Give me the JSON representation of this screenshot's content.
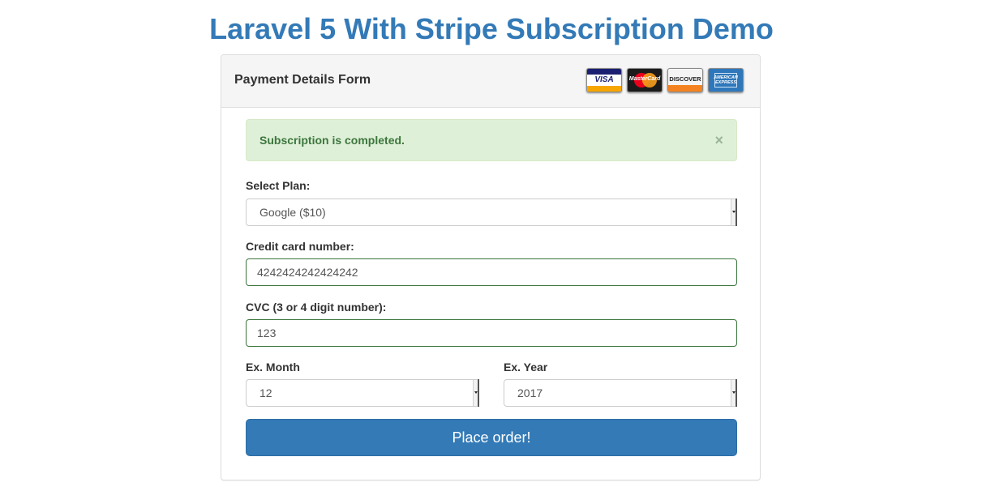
{
  "page": {
    "title": "Laravel 5 With Stripe Subscription Demo"
  },
  "panel": {
    "title": "Payment Details Form",
    "cards": [
      {
        "name": "visa",
        "text": "VISA"
      },
      {
        "name": "mastercard",
        "text": "MasterCard"
      },
      {
        "name": "discover",
        "text": "DISCOVER"
      },
      {
        "name": "american-express",
        "text": "AMERICAN EXPRESS"
      }
    ]
  },
  "alert": {
    "message": "Subscription is completed.",
    "close_symbol": "×"
  },
  "form": {
    "plan": {
      "label": "Select Plan:",
      "value": "Google ($10)"
    },
    "card_number": {
      "label": "Credit card number:",
      "value": "4242424242424242"
    },
    "cvc": {
      "label": "CVC (3 or 4 digit number):",
      "value": "123"
    },
    "exp_month": {
      "label": "Ex. Month",
      "value": "12"
    },
    "exp_year": {
      "label": "Ex. Year",
      "value": "2017"
    },
    "submit_label": "Place order!"
  },
  "colors": {
    "title": "#337ab7",
    "primary_button": "#337ab7",
    "alert_background": "#dff0d8",
    "alert_text": "#3c763d",
    "valid_border": "#3c763d"
  }
}
